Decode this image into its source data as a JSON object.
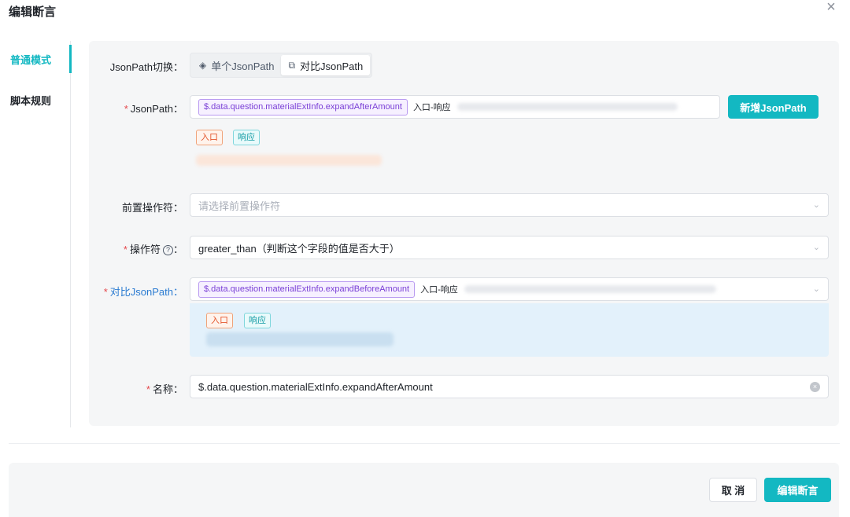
{
  "dialog": {
    "title": "编辑断言",
    "close_icon": "×"
  },
  "nav": {
    "items": [
      {
        "label": "普通模式",
        "active": true
      },
      {
        "label": "脚本规则",
        "active": false
      }
    ]
  },
  "jsonpath_switch": {
    "label": "JsonPath切换：",
    "options": [
      {
        "label": "单个JsonPath",
        "icon": "target-icon",
        "glyph": "◈",
        "selected": false
      },
      {
        "label": "对比JsonPath",
        "icon": "compare-icon",
        "glyph": "⧉",
        "selected": true
      }
    ]
  },
  "jsonpath": {
    "label": "JsonPath：",
    "tag": "$.data.question.materialExtInfo.expandAfterAmount",
    "inline_text": "入口-响应",
    "add_button": "新增JsonPath",
    "chips": [
      "入口",
      "响应"
    ]
  },
  "pre_operator": {
    "label": "前置操作符：",
    "placeholder": "请选择前置操作符",
    "chevron": "⌄"
  },
  "operator": {
    "label": "操作符",
    "help_icon": "?",
    "colon": "：",
    "value": "greater_than（判断这个字段的值是否大于）"
  },
  "compare_jsonpath": {
    "label": "对比JsonPath：",
    "tag": "$.data.question.materialExtInfo.expandBeforeAmount",
    "inline_text": "入口-响应",
    "chips": [
      "入口",
      "响应"
    ]
  },
  "name": {
    "label": "名称：",
    "value": "$.data.question.materialExtInfo.expandAfterAmount",
    "clear_icon": "×"
  },
  "required_mark": "*",
  "footer": {
    "cancel": "取 消",
    "submit": "编辑断言"
  },
  "colors": {
    "accent": "#13b8c2",
    "required": "#e5484d",
    "link": "#2a7bd1"
  }
}
